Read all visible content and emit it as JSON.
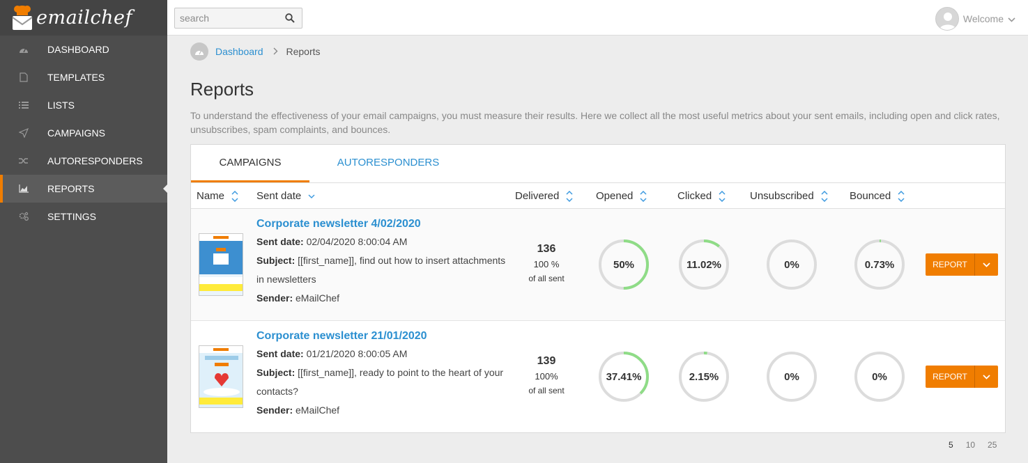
{
  "brand": {
    "name": "emailchef",
    "accent": "#f07d00",
    "link": "#2b8fd0"
  },
  "sidebar": {
    "items": [
      {
        "label": "DASHBOARD",
        "icon": "dashboard-icon"
      },
      {
        "label": "TEMPLATES",
        "icon": "file-icon"
      },
      {
        "label": "LISTS",
        "icon": "list-icon"
      },
      {
        "label": "CAMPAIGNS",
        "icon": "paper-plane-icon"
      },
      {
        "label": "AUTORESPONDERS",
        "icon": "shuffle-icon"
      },
      {
        "label": "REPORTS",
        "icon": "area-chart-icon",
        "active": true
      },
      {
        "label": "SETTINGS",
        "icon": "gears-icon"
      }
    ]
  },
  "topbar": {
    "search_placeholder": "search",
    "welcome_label": "Welcome"
  },
  "breadcrumb": {
    "home": "Dashboard",
    "current": "Reports"
  },
  "page": {
    "title": "Reports",
    "description": "To understand the effectiveness of your email campaigns, you must measure their results. Here we collect all the most useful metrics about your sent emails, including open and click rates, unsubscribes, spam complaints, and bounces."
  },
  "tabs": [
    {
      "label": "CAMPAIGNS",
      "active": true
    },
    {
      "label": "AUTORESPONDERS",
      "active": false
    }
  ],
  "table": {
    "columns": {
      "name": "Name",
      "sent_date": "Sent date",
      "delivered": "Delivered",
      "opened": "Opened",
      "clicked": "Clicked",
      "unsubscribed": "Unsubscribed",
      "bounced": "Bounced"
    },
    "labels": {
      "sent_date": "Sent date:",
      "subject": "Subject:",
      "sender": "Sender:",
      "of_all_sent": "of all sent",
      "report": "REPORT"
    },
    "rows": [
      {
        "title": "Corporate newsletter 4/02/2020",
        "sent_date": "02/04/2020 8:00:04 AM",
        "subject": "[[first_name]], find out how to insert attachments in newsletters",
        "sender": "eMailChef",
        "delivered": "136",
        "delivered_pct": "100 %",
        "opened": {
          "label": "50%",
          "value": 0.5
        },
        "clicked": {
          "label": "11.02%",
          "value": 0.1102
        },
        "unsubscribed": {
          "label": "0%",
          "value": 0
        },
        "bounced": {
          "label": "0.73%",
          "value": 0.0073
        }
      },
      {
        "title": "Corporate newsletter 21/01/2020",
        "sent_date": "01/21/2020 8:00:05 AM",
        "subject": "[[first_name]], ready to point to the heart of your contacts?",
        "sender": "eMailChef",
        "delivered": "139",
        "delivered_pct": "100%",
        "opened": {
          "label": "37.41%",
          "value": 0.3741
        },
        "clicked": {
          "label": "2.15%",
          "value": 0.0215
        },
        "unsubscribed": {
          "label": "0%",
          "value": 0
        },
        "bounced": {
          "label": "0%",
          "value": 0
        }
      }
    ]
  },
  "pager": {
    "sizes": [
      "5",
      "10",
      "25"
    ],
    "current": "5"
  },
  "colors": {
    "ring_track": "#dcdcdc",
    "ring_fill": "#8fdc87"
  }
}
